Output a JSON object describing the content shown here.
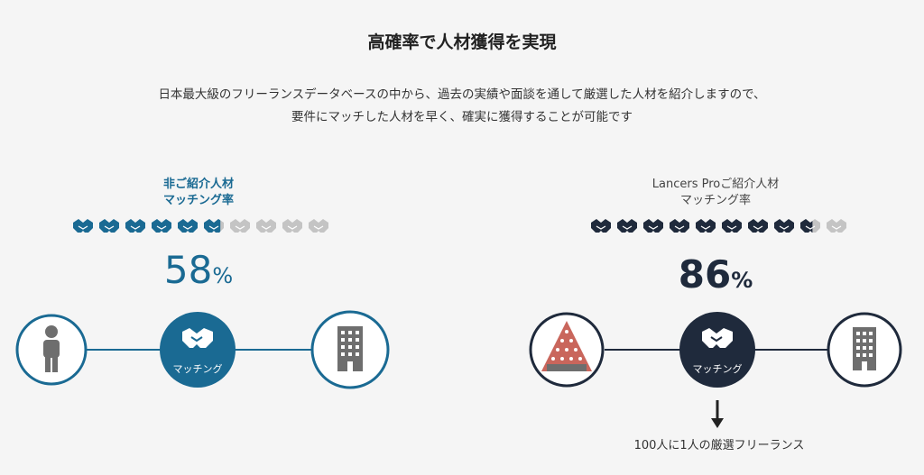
{
  "title": "高確率で人材獲得を実現",
  "description": {
    "line1": "日本最大級のフリーランスデータベースの中から、過去の実績や面談を通して厳選した人材を紹介しますので、",
    "line2": "要件にマッチした人材を早く、確実に獲得することが可能です"
  },
  "left": {
    "label_line1": "非ご紹介人材",
    "label_line2": "マッチング率",
    "rate_value": "58",
    "rate_unit": "%",
    "rate_fraction": 0.58,
    "icon_count": 10,
    "matching_label": "マッチング",
    "accent_color": "#1a6a93"
  },
  "right": {
    "label_line1": "Lancers Proご紹介人材",
    "label_line2": "マッチング率",
    "rate_value": "86",
    "rate_unit": "%",
    "rate_fraction": 0.86,
    "icon_count": 10,
    "matching_label": "マッチング",
    "accent_color": "#1f2a3c",
    "caption": "100人に1人の厳選フリーランス"
  },
  "colors": {
    "inactive_icon": "#c4c4c4",
    "gray_icon": "#6e6e6e",
    "background": "#f5f5f5"
  },
  "icons": {
    "rating": "handshake-icon",
    "person": "person-icon",
    "building": "building-icon",
    "pyramid": "pyramid-icon",
    "arrow": "arrow-down-icon"
  }
}
